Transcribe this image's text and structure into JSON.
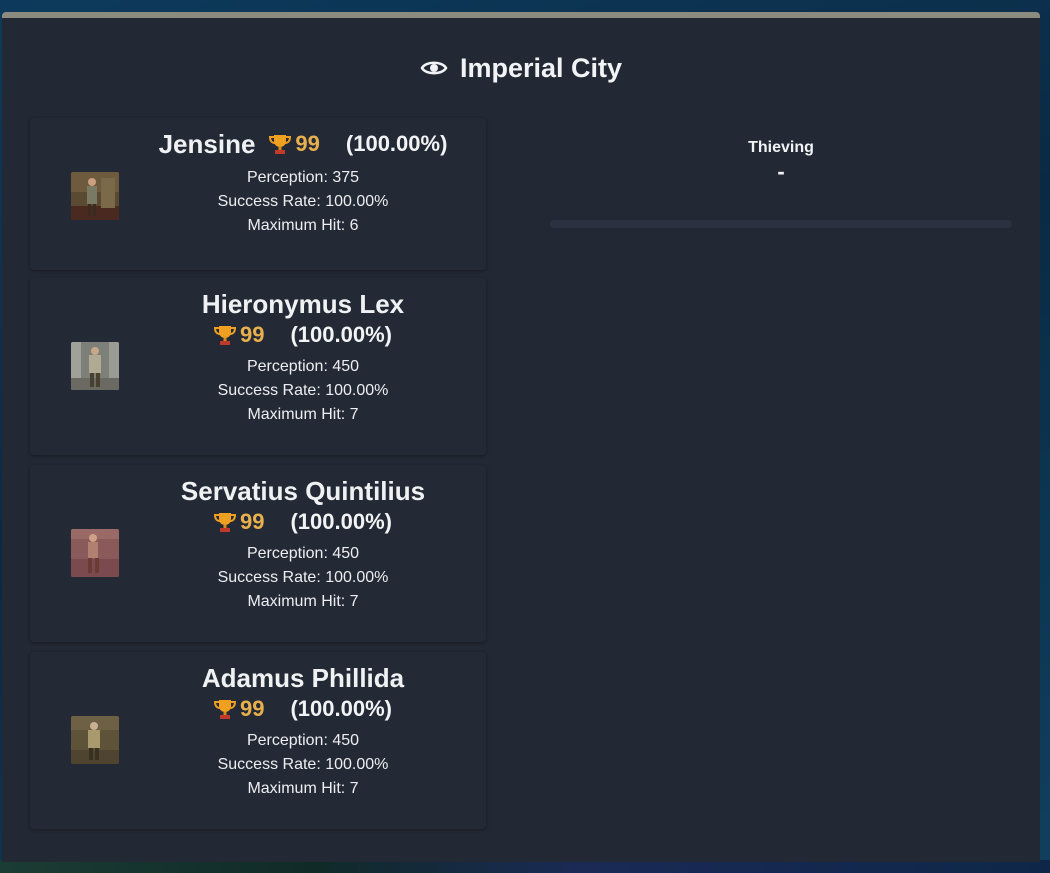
{
  "location": {
    "title": "Imperial City",
    "icon": "eye-icon"
  },
  "labels": {
    "perception_prefix": "Perception: ",
    "success_prefix": "Success Rate: ",
    "maxhit_prefix": "Maximum Hit: "
  },
  "npcs": [
    {
      "name": "Jensine",
      "mastery_level": "99",
      "mastery_percent": "(100.00%)",
      "perception": "Perception: 375",
      "success_rate": "Success Rate: 100.00%",
      "max_hit": "Maximum Hit: 6"
    },
    {
      "name": "Hieronymus Lex",
      "mastery_level": "99",
      "mastery_percent": "(100.00%)",
      "perception": "Perception: 450",
      "success_rate": "Success Rate: 100.00%",
      "max_hit": "Maximum Hit: 7"
    },
    {
      "name": "Servatius Quintilius",
      "mastery_level": "99",
      "mastery_percent": "(100.00%)",
      "perception": "Perception: 450",
      "success_rate": "Success Rate: 100.00%",
      "max_hit": "Maximum Hit: 7"
    },
    {
      "name": "Adamus Phillida",
      "mastery_level": "99",
      "mastery_percent": "(100.00%)",
      "perception": "Perception: 450",
      "success_rate": "Success Rate: 100.00%",
      "max_hit": "Maximum Hit: 7"
    }
  ],
  "skill_panel": {
    "title": "Thieving",
    "current_target": "-",
    "progress": 0
  },
  "colors": {
    "panel_bg": "#222834",
    "card_bg": "#242a35",
    "mastery_gold": "#e8b04d",
    "panel_top_border": "#8b8b80"
  }
}
